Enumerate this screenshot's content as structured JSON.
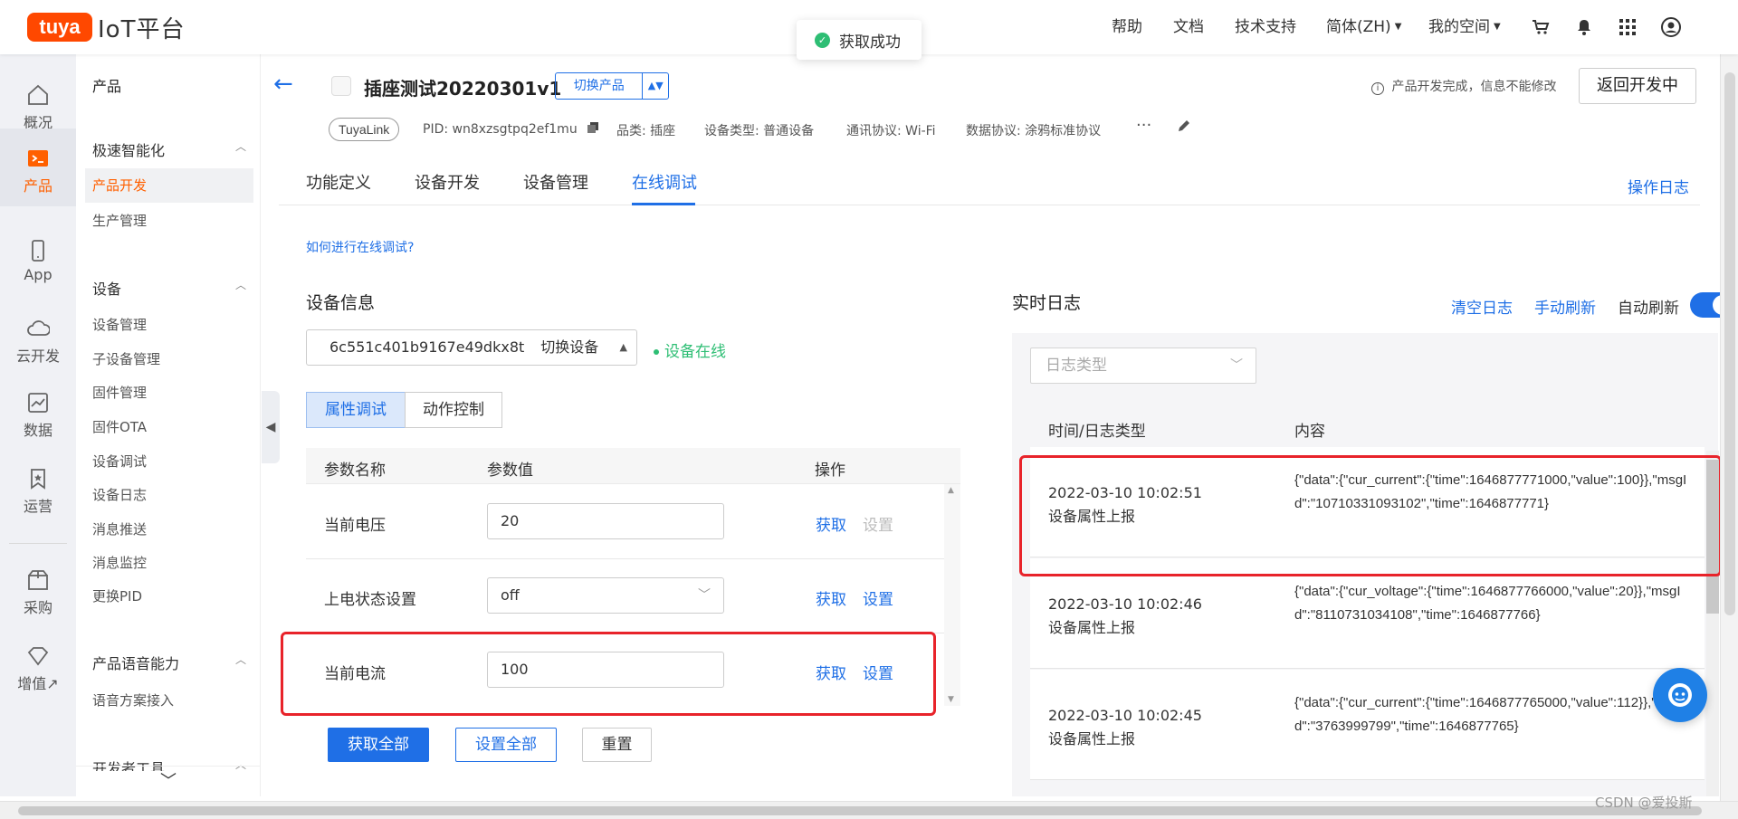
{
  "brand": {
    "logo": "tuya",
    "platform": "IoT平台"
  },
  "topnav": {
    "help": "帮助",
    "docs": "文档",
    "support": "技术支持",
    "language": "简体(ZH)",
    "space": "我的空间"
  },
  "toast": {
    "text": "获取成功",
    "color": "#2ebe74"
  },
  "rail": [
    {
      "label": "概况",
      "icon": "home-icon"
    },
    {
      "label": "产品",
      "icon": "terminal-icon"
    },
    {
      "label": "App",
      "icon": "phone-icon"
    },
    {
      "label": "云开发",
      "icon": "cloud-icon"
    },
    {
      "label": "数据",
      "icon": "chart-icon"
    },
    {
      "label": "运营",
      "icon": "bookmark-icon"
    },
    {
      "label": "采购",
      "icon": "box-icon"
    },
    {
      "label": "增值↗",
      "icon": "diamond-icon"
    }
  ],
  "menu": {
    "title": "产品",
    "group1": "极速智能化",
    "group1_items": [
      "产品开发",
      "生产管理"
    ],
    "group2": "设备",
    "group2_items": [
      "设备管理",
      "子设备管理",
      "固件管理",
      "固件OTA",
      "设备调试",
      "设备日志",
      "消息推送",
      "消息监控",
      "更换PID"
    ],
    "group3": "产品语音能力",
    "group3_items": [
      "语音方案接入"
    ],
    "group4": "开发者工具"
  },
  "product": {
    "name": "插座测试20220301v1",
    "switch_label": "切换产品",
    "tag": "TuyaLink",
    "pid": "PID: wn8xzsgtpq2ef1mu",
    "category": "品类: 插座",
    "device_type": "设备类型: 普通设备",
    "protocol": "通讯协议: Wi-Fi",
    "data_protocol": "数据协议: 涂鸦标准协议",
    "more": "···",
    "note": "产品开发完成，信息不能修改",
    "back_button": "返回开发中"
  },
  "tabs": [
    "功能定义",
    "设备开发",
    "设备管理",
    "在线调试"
  ],
  "active_tab": 3,
  "operation_log": "操作日志",
  "help_link": "如何进行在线调试?",
  "device": {
    "section_title": "设备信息",
    "id": "6c551c401b9167e49dkx8t",
    "switch_label": "切换设备",
    "status": "设备在线"
  },
  "subtabs": [
    "属性调试",
    "动作控制"
  ],
  "param_table": {
    "headers": [
      "参数名称",
      "参数值",
      "操作"
    ],
    "rows": [
      {
        "name": "当前电压",
        "value": "20",
        "get": "获取",
        "set": "设置",
        "dropdown": false,
        "set_disabled": true
      },
      {
        "name": "上电状态设置",
        "value": "off",
        "get": "获取",
        "set": "设置",
        "dropdown": true,
        "set_disabled": false
      },
      {
        "name": "当前电流",
        "value": "100",
        "get": "获取",
        "set": "设置",
        "dropdown": false,
        "set_disabled": false
      }
    ]
  },
  "buttons": {
    "get_all": "获取全部",
    "set_all": "设置全部",
    "reset": "重置"
  },
  "log": {
    "section_title": "实时日志",
    "clear": "清空日志",
    "refresh": "手动刷新",
    "auto": "自动刷新",
    "type_placeholder": "日志类型",
    "headers": [
      "时间/日志类型",
      "内容"
    ],
    "entries": [
      {
        "time": "2022-03-10 10:02:51",
        "type": "设备属性上报",
        "content": "{\"data\":{\"cur_current\":{\"time\":1646877771000,\"value\":100}},\"msgId\":\"10710331093102\",\"time\":1646877771}"
      },
      {
        "time": "2022-03-10 10:02:46",
        "type": "设备属性上报",
        "content": "{\"data\":{\"cur_voltage\":{\"time\":1646877766000,\"value\":20}},\"msgId\":\"8110731034108\",\"time\":1646877766}"
      },
      {
        "time": "2022-03-10 10:02:45",
        "type": "设备属性上报",
        "content": "{\"data\":{\"cur_current\":{\"time\":1646877765000,\"value\":112}},\"msgId\":\"3763999799\",\"time\":1646877765}"
      }
    ]
  },
  "watermark": "CSDN @爱投斯",
  "colors": {
    "primary": "#1f6fe6",
    "brand": "#ff4800",
    "highlight": "#e8232a",
    "online": "#2ebe74"
  }
}
